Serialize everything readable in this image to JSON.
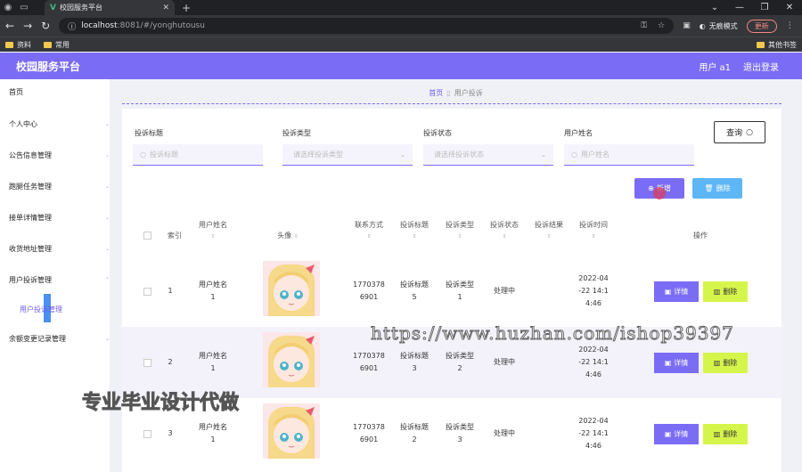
{
  "browser": {
    "tab_title": "校园服务平台",
    "url_host": "localhost",
    "url_path": ":8081/#/yonghutousu",
    "incognito_label": "无痕模式",
    "update_label": "更新",
    "bookmarks": [
      "资料",
      "常用"
    ],
    "bookmarks_right": "其他书签"
  },
  "header": {
    "brand": "校园服务平台",
    "user": "用户 a1",
    "logout": "退出登录"
  },
  "sidebar": {
    "items": [
      "首页",
      "个人中心",
      "公告信息管理",
      "跑腿任务管理",
      "接单详情管理",
      "收货地址管理",
      "用户投诉管理"
    ],
    "sub_item": "用户投诉管理",
    "last_item": "余额变更记录管理"
  },
  "breadcrumb": {
    "home": "首页",
    "current": "用户投诉"
  },
  "filters": {
    "f1_label": "投诉标题",
    "f1_placeholder": "投诉标题",
    "f2_label": "投诉类型",
    "f2_placeholder": "请选择投诉类型",
    "f3_label": "投诉状态",
    "f3_placeholder": "请选择投诉状态",
    "f4_label": "用户姓名",
    "f4_placeholder": "用户姓名",
    "query_label": "查询"
  },
  "actions": {
    "add": "新增",
    "delete": "删除"
  },
  "table": {
    "headers": {
      "index": "索引",
      "name": "用户姓名",
      "avatar": "头像",
      "contact": "联系方式",
      "title": "投诉标题",
      "type": "投诉类型",
      "status": "投诉状态",
      "result": "投诉结果",
      "time": "投诉时间",
      "ops": "操作"
    },
    "rows": [
      {
        "index": "1",
        "name_a": "用户姓名",
        "name_b": "1",
        "phone_a": "1770378",
        "phone_b": "6901",
        "title_a": "投诉标题",
        "title_b": "5",
        "type_a": "投诉类型",
        "type_b": "1",
        "status": "处理中",
        "time_a": "2022-04",
        "time_b": "-22 14:1",
        "time_c": "4:46"
      },
      {
        "index": "2",
        "name_a": "用户姓名",
        "name_b": "1",
        "phone_a": "1770378",
        "phone_b": "6901",
        "title_a": "投诉标题",
        "title_b": "3",
        "type_a": "投诉类型",
        "type_b": "2",
        "status": "处理中",
        "time_a": "2022-04",
        "time_b": "-22 14:1",
        "time_c": "4:46"
      },
      {
        "index": "3",
        "name_a": "用户姓名",
        "name_b": "1",
        "phone_a": "1770378",
        "phone_b": "6901",
        "title_a": "投诉标题",
        "title_b": "2",
        "type_a": "投诉类型",
        "type_b": "3",
        "status": "处理中",
        "time_a": "2022-04",
        "time_b": "-22 14:1",
        "time_c": "4:46"
      }
    ],
    "detail_label": "详情",
    "delete_label": "删除"
  },
  "watermark": {
    "url": "https://www.huzhan.com/ishop39397",
    "text": "专业毕业设计代做"
  },
  "colors": {
    "accent": "#7b6cf6",
    "danger_btn": "#d6f54a",
    "info_btn": "#5fb6f5"
  }
}
